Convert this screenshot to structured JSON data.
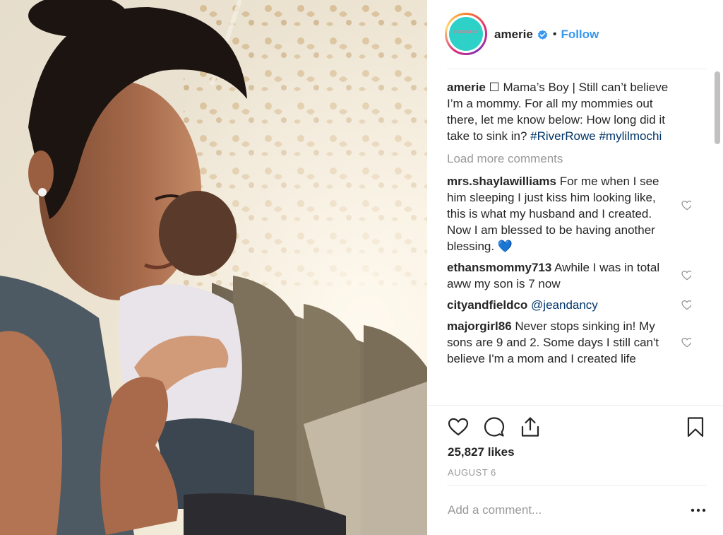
{
  "post": {
    "username": "amerie",
    "avatar_text": "OCTOBER 18",
    "follow_label": "Follow",
    "separator": "•",
    "likes": "25,827 likes",
    "date": "AUGUST 6"
  },
  "caption": {
    "username": "amerie",
    "text": " ☐ Mama’s Boy | Still can’t believe I’m a mommy. For all my mommies out there, let me know below: How long did it take to sink in? ",
    "hashtag1": "#RiverRowe",
    "space": " ",
    "hashtag2": "#mylilmochi"
  },
  "load_more_label": "Load more comments",
  "comments": [
    {
      "username": "mrs.shaylawilliams",
      "text": " For me when I see him sleeping I just kiss him looking like, this is what my husband and I created. Now I am blessed to be having another blessing. 💙"
    },
    {
      "username": "ethansmommy713",
      "text": " Awhile I was in total aww my son is 7 now"
    },
    {
      "username": "cityandfieldco",
      "text": " ",
      "mention": "@jeandancy"
    },
    {
      "username": "majorgirl86",
      "text": " Never stops sinking in! My sons are 9 and 2. Some days I still can't believe I'm a mom and I created life"
    }
  ],
  "add_comment": {
    "placeholder": "Add a comment...",
    "more_glyph": "•••"
  },
  "icons": {
    "verified": "verified-badge-icon",
    "like": "heart-icon",
    "comment": "comment-icon",
    "share": "share-icon",
    "save": "bookmark-icon",
    "comment_like": "heart-icon",
    "more": "more-options-icon"
  },
  "colors": {
    "follow": "#3897f0",
    "verified": "#3897f0",
    "hashtag": "#003569",
    "muted": "#999999",
    "avatar_bg": "#2ed1c8"
  }
}
